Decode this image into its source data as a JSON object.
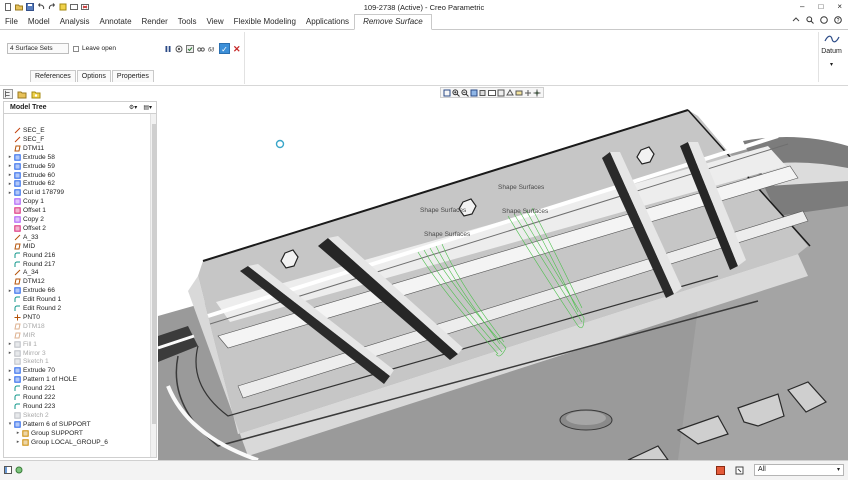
{
  "window": {
    "title": "109-2738 (Active) - Creo Parametric"
  },
  "menu": {
    "items": [
      "File",
      "Model",
      "Analysis",
      "Annotate",
      "Render",
      "Tools",
      "View",
      "Flexible Modeling",
      "Applications"
    ],
    "active_tab": "Remove Surface"
  },
  "ribbon": {
    "surface_sets": "4 Surface Sets",
    "leave_open_label": "Leave open",
    "leave_open_checked": false,
    "sub_tabs": [
      "References",
      "Options",
      "Properties"
    ],
    "datum_label": "Datum"
  },
  "tree": {
    "title": "Model Tree",
    "rows": [
      {
        "label": "SEC_E",
        "icon": "datum-curve-icon",
        "expand": false,
        "dim": false,
        "indent": 0
      },
      {
        "label": "SEC_F",
        "icon": "datum-curve-icon",
        "expand": false,
        "dim": false,
        "indent": 0
      },
      {
        "label": "DTM11",
        "icon": "datum-plane-icon",
        "expand": false,
        "dim": false,
        "indent": 0
      },
      {
        "label": "Extrude 58",
        "icon": "extrude-icon",
        "expand": true,
        "dim": false,
        "indent": 0
      },
      {
        "label": "Extrude 59",
        "icon": "extrude-icon",
        "expand": true,
        "dim": false,
        "indent": 0
      },
      {
        "label": "Extrude 60",
        "icon": "extrude-icon",
        "expand": true,
        "dim": false,
        "indent": 0
      },
      {
        "label": "Extrude 62",
        "icon": "extrude-icon",
        "expand": true,
        "dim": false,
        "indent": 0
      },
      {
        "label": "Cut id 178799",
        "icon": "cut-icon",
        "expand": true,
        "dim": false,
        "indent": 0
      },
      {
        "label": "Copy 1",
        "icon": "copy-icon",
        "expand": false,
        "dim": false,
        "indent": 0
      },
      {
        "label": "Offset 1",
        "icon": "offset-icon",
        "expand": false,
        "dim": false,
        "indent": 0
      },
      {
        "label": "Copy 2",
        "icon": "copy-icon",
        "expand": false,
        "dim": false,
        "indent": 0
      },
      {
        "label": "Offset 2",
        "icon": "offset-icon",
        "expand": false,
        "dim": false,
        "indent": 0
      },
      {
        "label": "A_33",
        "icon": "axis-icon",
        "expand": false,
        "dim": false,
        "indent": 0
      },
      {
        "label": "MID",
        "icon": "datum-plane-icon",
        "expand": false,
        "dim": false,
        "indent": 0
      },
      {
        "label": "Round 216",
        "icon": "round-icon",
        "expand": false,
        "dim": false,
        "indent": 0
      },
      {
        "label": "Round 217",
        "icon": "round-icon",
        "expand": false,
        "dim": false,
        "indent": 0
      },
      {
        "label": "A_34",
        "icon": "axis-icon",
        "expand": false,
        "dim": false,
        "indent": 0
      },
      {
        "label": "DTM12",
        "icon": "datum-plane-icon",
        "expand": false,
        "dim": false,
        "indent": 0
      },
      {
        "label": "Extrude 66",
        "icon": "extrude-icon",
        "expand": true,
        "dim": false,
        "indent": 0
      },
      {
        "label": "Edit Round 1",
        "icon": "edit-round-icon",
        "expand": false,
        "dim": false,
        "indent": 0
      },
      {
        "label": "Edit Round 2",
        "icon": "edit-round-icon",
        "expand": false,
        "dim": false,
        "indent": 0
      },
      {
        "label": "PNT0",
        "icon": "datum-point-icon",
        "expand": false,
        "dim": false,
        "indent": 0
      },
      {
        "label": "DTM18",
        "icon": "datum-plane-icon",
        "expand": false,
        "dim": true,
        "indent": 0
      },
      {
        "label": "MIR",
        "icon": "datum-plane-icon",
        "expand": false,
        "dim": true,
        "indent": 0
      },
      {
        "label": "Fill 1",
        "icon": "fill-icon",
        "expand": true,
        "dim": true,
        "indent": 0
      },
      {
        "label": "Mirror 3",
        "icon": "mirror-icon",
        "expand": true,
        "dim": true,
        "indent": 0
      },
      {
        "label": "Sketch 1",
        "icon": "sketch-icon",
        "expand": false,
        "dim": true,
        "indent": 0
      },
      {
        "label": "Extrude 70",
        "icon": "extrude-icon",
        "expand": true,
        "dim": false,
        "indent": 0
      },
      {
        "label": "Pattern 1 of HOLE",
        "icon": "pattern-icon",
        "expand": true,
        "dim": false,
        "indent": 0
      },
      {
        "label": "Round 221",
        "icon": "round-icon",
        "expand": false,
        "dim": false,
        "indent": 0
      },
      {
        "label": "Round 222",
        "icon": "round-icon",
        "expand": false,
        "dim": false,
        "indent": 0
      },
      {
        "label": "Round 223",
        "icon": "round-icon",
        "expand": false,
        "dim": false,
        "indent": 0
      },
      {
        "label": "Sketch 2",
        "icon": "sketch-icon",
        "expand": false,
        "dim": true,
        "indent": 0
      },
      {
        "label": "Pattern 6 of SUPPORT",
        "icon": "pattern-icon",
        "expand": "open",
        "dim": false,
        "indent": 0
      },
      {
        "label": "Group SUPPORT",
        "icon": "group-icon",
        "expand": true,
        "dim": false,
        "indent": 1
      },
      {
        "label": "Group LOCAL_GROUP_6",
        "icon": "group-icon",
        "expand": true,
        "dim": false,
        "indent": 1
      }
    ]
  },
  "graphics": {
    "annotations": [
      "Shape Surfaces",
      "Shape Surfaces",
      "Shape Surfaces",
      "Shape Surfaces"
    ]
  },
  "status": {
    "filter_value": "All"
  },
  "colors": {
    "accent": "#3c8fd8",
    "cancel": "#c62828",
    "highlight": "#4cbf4c",
    "model_grey": "#bdbdbd"
  }
}
